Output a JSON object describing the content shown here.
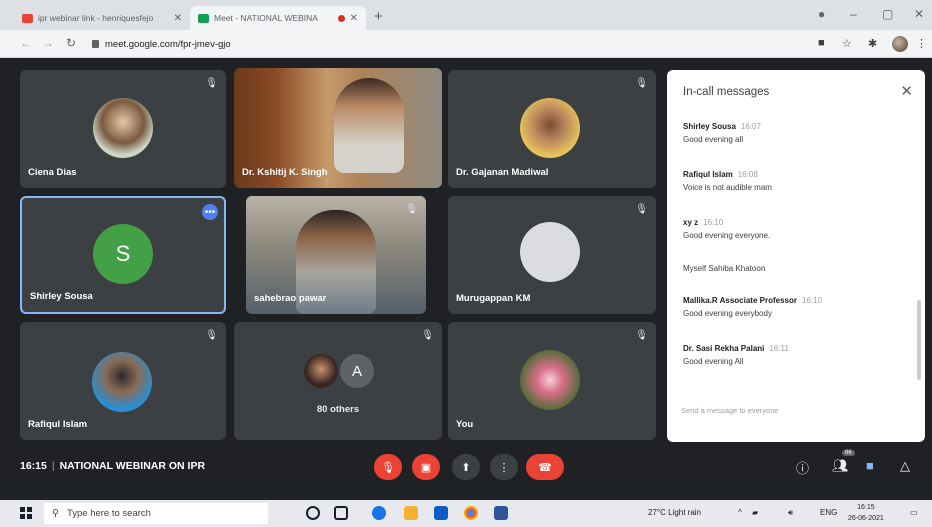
{
  "browser": {
    "tabs": [
      {
        "title": "ipr webinar link - henriquesfejo",
        "active": false
      },
      {
        "title": "Meet - NATIONAL WEBINA",
        "active": true
      }
    ],
    "url": "meet.google.com/fpr-jmev-gjo"
  },
  "meet": {
    "tiles": [
      {
        "name": "Ciena Dias",
        "type": "photo"
      },
      {
        "name": "Dr. Kshitij K. Singh",
        "type": "video"
      },
      {
        "name": "Dr. Gajanan Madiwal",
        "type": "photo"
      },
      {
        "name": "Shirley Sousa",
        "type": "letter",
        "letter": "S",
        "color": "#43a047"
      },
      {
        "name": "sahebrao pawar",
        "type": "video"
      },
      {
        "name": "Murugappan KM",
        "type": "placeholder"
      },
      {
        "name": "Rafiqul Islam",
        "type": "photo"
      },
      {
        "name": "80 others",
        "type": "group",
        "letter": "A",
        "color": "#5f6368"
      },
      {
        "name": "You",
        "type": "photo"
      }
    ]
  },
  "chat": {
    "title": "In-call messages",
    "messages": [
      {
        "sender": "Shirley Sousa",
        "time": "16:07",
        "text": "Good evening all"
      },
      {
        "sender": "Rafiqul Islam",
        "time": "16:08",
        "text": "Voice is not audible mam"
      },
      {
        "sender": "xy z",
        "time": "16:10",
        "text": "Good evening everyone."
      },
      {
        "sender": "",
        "time": "",
        "text": "Myself Sahiba Khatoon"
      },
      {
        "sender": "Mallika.R Associate Professor",
        "time": "16:10",
        "text": "Good evening everybody"
      },
      {
        "sender": "Dr. Sasi Rekha Palani",
        "time": "16:11",
        "text": "Good evening All"
      }
    ],
    "input_placeholder": "Send a message to everyone"
  },
  "bottombar": {
    "time": "16:15",
    "meeting_title": "NATIONAL WEBINAR ON IPR",
    "participants_count": "86"
  },
  "taskbar": {
    "search_placeholder": "Type here to search",
    "weather": "27°C Light rain",
    "language": "ENG",
    "time": "16:15",
    "date": "26-06-2021"
  },
  "colors": {
    "meet_bg": "#202124",
    "tile_bg": "#3c4043",
    "accent_red": "#ea4335",
    "active_border": "#8ab4f8"
  }
}
